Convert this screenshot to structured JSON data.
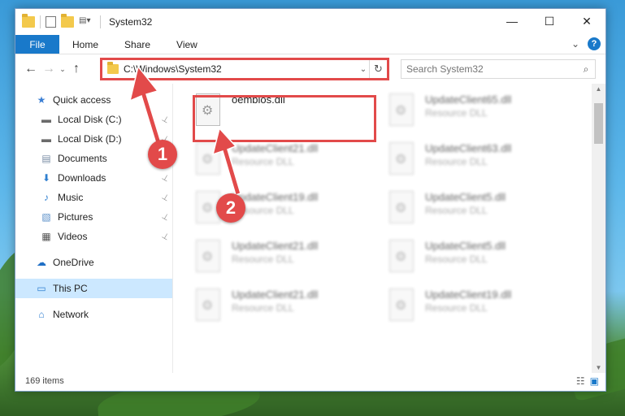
{
  "window": {
    "title": "System32"
  },
  "title_controls": {
    "minimize": "—",
    "maximize": "☐",
    "close": "✕"
  },
  "ribbon": {
    "tabs": [
      "File",
      "Home",
      "Share",
      "View"
    ],
    "expand_glyph": "⌄",
    "help_glyph": "?"
  },
  "nav": {
    "back": "←",
    "forward": "→",
    "recent": "⌄",
    "up": "↑",
    "address_path": "C:\\Windows\\System32",
    "address_dropdown": "⌄",
    "refresh": "↻",
    "search_placeholder": "Search System32",
    "search_glyph": "⌕"
  },
  "sidebar": {
    "items": [
      {
        "label": "Quick access",
        "icon": "star-icon",
        "glyph": "★",
        "color": "#3b7fd4",
        "level": 0,
        "pinned": false
      },
      {
        "label": "Local Disk (C:)",
        "icon": "drive-icon",
        "glyph": "▬",
        "color": "#6b6b6b",
        "level": 1,
        "pinned": true
      },
      {
        "label": "Local Disk (D:)",
        "icon": "drive-icon",
        "glyph": "▬",
        "color": "#6b6b6b",
        "level": 1,
        "pinned": true
      },
      {
        "label": "Documents",
        "icon": "documents-icon",
        "glyph": "▤",
        "color": "#7a8da5",
        "level": 1,
        "pinned": true
      },
      {
        "label": "Downloads",
        "icon": "downloads-icon",
        "glyph": "⬇",
        "color": "#2f7fd0",
        "level": 1,
        "pinned": true
      },
      {
        "label": "Music",
        "icon": "music-icon",
        "glyph": "♪",
        "color": "#2f7fd0",
        "level": 1,
        "pinned": true
      },
      {
        "label": "Pictures",
        "icon": "pictures-icon",
        "glyph": "▧",
        "color": "#5a8fc8",
        "level": 1,
        "pinned": true
      },
      {
        "label": "Videos",
        "icon": "videos-icon",
        "glyph": "▦",
        "color": "#555555",
        "level": 1,
        "pinned": true
      },
      {
        "label": "OneDrive",
        "icon": "onedrive-icon",
        "glyph": "☁",
        "color": "#1f6fc5",
        "level": 0,
        "pinned": false
      },
      {
        "label": "This PC",
        "icon": "this-pc-icon",
        "glyph": "▭",
        "color": "#2f7fd0",
        "level": 0,
        "pinned": false,
        "selected": true
      },
      {
        "label": "Network",
        "icon": "network-icon",
        "glyph": "⌂",
        "color": "#2f7fd0",
        "level": 0,
        "pinned": false
      }
    ],
    "pin_glyph": "📌"
  },
  "files": [
    {
      "name": "oembios.dll",
      "type": "",
      "blurred": false
    },
    {
      "name": "UpdateClient65.dll",
      "type": "Resource DLL",
      "blurred": true
    },
    {
      "name": "UpdateClient21.dll",
      "type": "Resource DLL",
      "blurred": true
    },
    {
      "name": "UpdateClient63.dll",
      "type": "Resource DLL",
      "blurred": true
    },
    {
      "name": "UpdateClient19.dll",
      "type": "Resource DLL",
      "blurred": true
    },
    {
      "name": "UpdateClient5.dll",
      "type": "Resource DLL",
      "blurred": true
    },
    {
      "name": "UpdateClient21.dll",
      "type": "Resource DLL",
      "blurred": true
    },
    {
      "name": "UpdateClient5.dll",
      "type": "Resource DLL",
      "blurred": true
    },
    {
      "name": "UpdateClient21.dll",
      "type": "Resource DLL",
      "blurred": true
    },
    {
      "name": "UpdateClient19.dll",
      "type": "Resource DLL",
      "blurred": true
    }
  ],
  "status": {
    "item_count": "169 items",
    "details_view_glyph": "☷",
    "tiles_view_glyph": "▣"
  },
  "annotations": {
    "badge_1": "1",
    "badge_2": "2",
    "highlight_color": "#e24a4a"
  }
}
